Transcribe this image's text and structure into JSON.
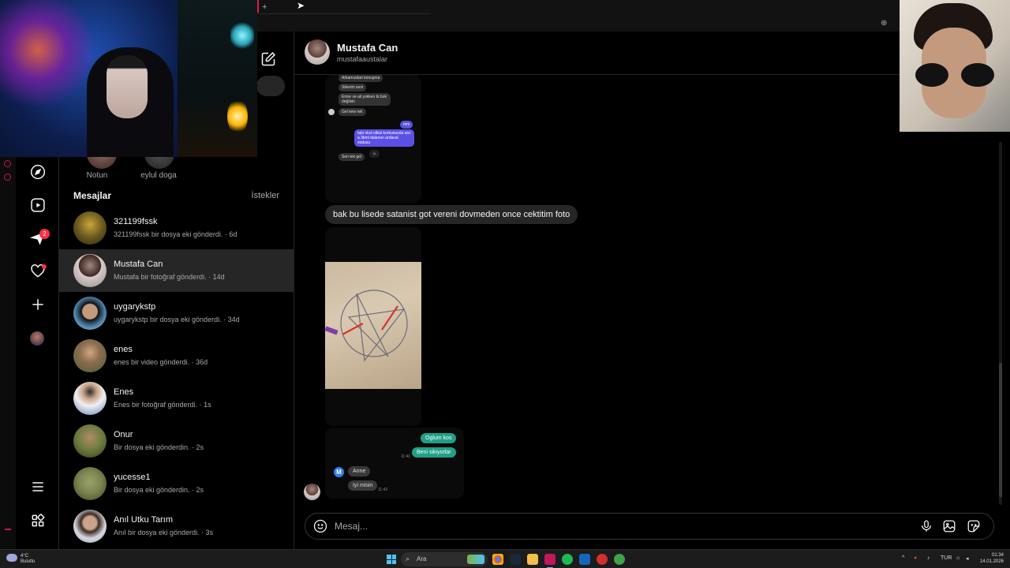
{
  "browser": {
    "new_tab": "+"
  },
  "notes": [
    {
      "label": "Notun"
    },
    {
      "label": "eylul doga"
    }
  ],
  "inbox": {
    "heading": "Mesajlar",
    "requests": "İstekler",
    "conversations": [
      {
        "name": "321199fssk",
        "preview": "321199fssk bir dosya eki gönderdi. · 6d",
        "avatar": "#6b5a1e",
        "active": false
      },
      {
        "name": "Mustafa Can",
        "preview": "Mustafa bir fotoğraf gönderdi. · 14d",
        "avatar": "#7a6a62",
        "active": true
      },
      {
        "name": "uygarykstp",
        "preview": "uygarykstp bir dosya eki gönderdi. · 34d",
        "avatar": "#4a7fa8",
        "active": false
      },
      {
        "name": "enes",
        "preview": "enes bir video gönderdi. · 36d",
        "avatar": "#8a6d4f",
        "active": false
      },
      {
        "name": "Enes",
        "preview": "Enes bir fotoğraf gönderdi. · 1s",
        "avatar": "#5b7fb5",
        "active": false
      },
      {
        "name": "Onur",
        "preview": "Bir dosya eki gönderdin. · 2s",
        "avatar": "#6b7a3c",
        "active": false
      },
      {
        "name": "yucesse1",
        "preview": "Bir dosya eki gönderdin. · 2s",
        "avatar": "#7d8550",
        "active": false
      },
      {
        "name": "Anıl Utku Tarım",
        "preview": "Anıl bir dosya eki gönderdi. · 3s",
        "avatar": "#9a9aa8",
        "active": false
      }
    ]
  },
  "rail": {
    "notifications_badge": "2"
  },
  "chat": {
    "title": "Mustafa Can",
    "handle": "mustafaaustalar",
    "screenshot1": {
      "gray_msgs": [
        "Arkamızdan konuşma",
        "Sikerim seni",
        "Emre ve ali yokken bi bok değilsin",
        "Gel teke tek",
        "Sen tek gel"
      ],
      "purple_msgs": [
        "mm",
        "tabi okul olkisi korkunuzda anc a 3kml dalarsın ardaval statusu"
      ]
    },
    "text_message": "bak bu lisede satanist got vereni dovmeden once cektitim foto",
    "screenshot3": {
      "green_msgs": [
        "Oglum kos",
        "Beni sikiyorlar"
      ],
      "gray_msgs": [
        "Anne",
        "Iyi misin"
      ],
      "avatar_letter": "M",
      "times": [
        "11:41",
        "11:42"
      ]
    },
    "composer_placeholder": "Mesaj..."
  },
  "taskbar": {
    "weather_temp": "4°C",
    "weather_desc": "Bulutlu",
    "search_label": "Ara",
    "language": "TUR",
    "time": "01:34",
    "date": "14.01.2026"
  }
}
